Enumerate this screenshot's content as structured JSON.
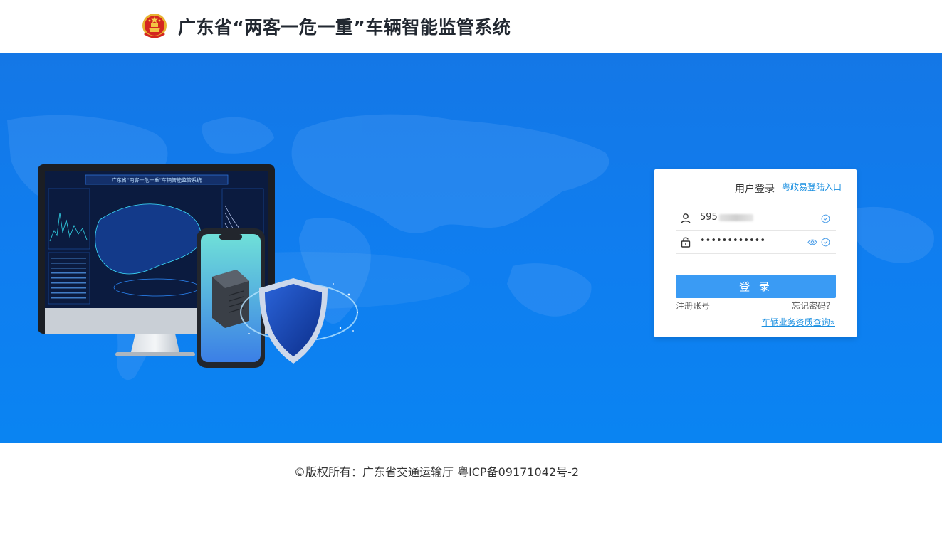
{
  "header": {
    "title": "广东省“两客一危一重”车辆智能监管系统"
  },
  "illustration": {
    "monitor_title": "广东省“两客一危一重”车辆智能监管系统"
  },
  "login": {
    "title": "用户登录",
    "gov_link": "粤政易登陆入口",
    "username_visible": "595",
    "password_mask": "••••••••••••",
    "submit_label": "登 录",
    "register_label": "注册账号",
    "forgot_label": "忘记密码？",
    "qualification_label": "车辆业务资质查询»"
  },
  "footer": {
    "copyright": "©版权所有：广东省交通运输厅 粤ICP备09171042号-2"
  },
  "colors": {
    "banner": "#0f7ef0",
    "button": "#3a9bf4",
    "link": "#1a8fe0"
  },
  "icons": {
    "emblem": "national-emblem-icon",
    "user": "user-icon",
    "lock": "lock-icon",
    "eye": "eye-icon",
    "check": "check-circle-icon"
  }
}
